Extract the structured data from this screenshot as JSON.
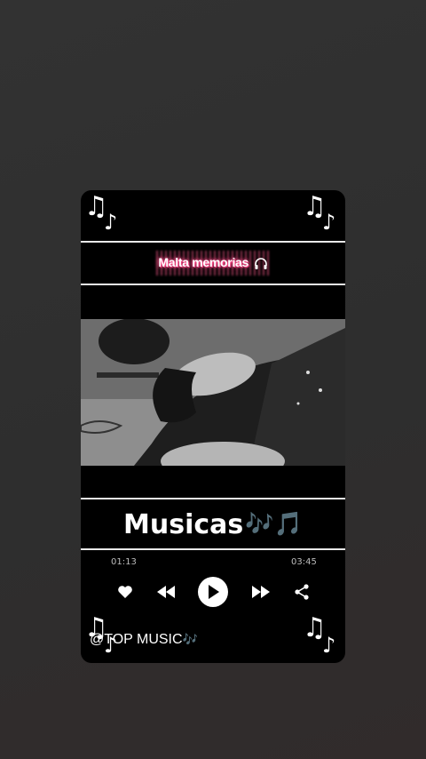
{
  "post": {
    "banner_title": "Malta memorias",
    "headline": "Musicas",
    "headline_emoji": "🎶🎵",
    "handle": "@TOP MUSIC",
    "handle_emoji": "🎶"
  },
  "player": {
    "elapsed": "01:13",
    "duration": "03:45"
  },
  "decor": {
    "note_glyph_big": "♫",
    "note_glyph_small": "♪"
  },
  "icons": [
    "headphones-icon",
    "heart-icon",
    "rewind-icon",
    "play-icon",
    "fast-forward-icon",
    "share-icon"
  ],
  "colors": {
    "card_bg": "#000000",
    "title_glow": "#ff4d8a",
    "emoji_tint": "#8fb3a8"
  }
}
